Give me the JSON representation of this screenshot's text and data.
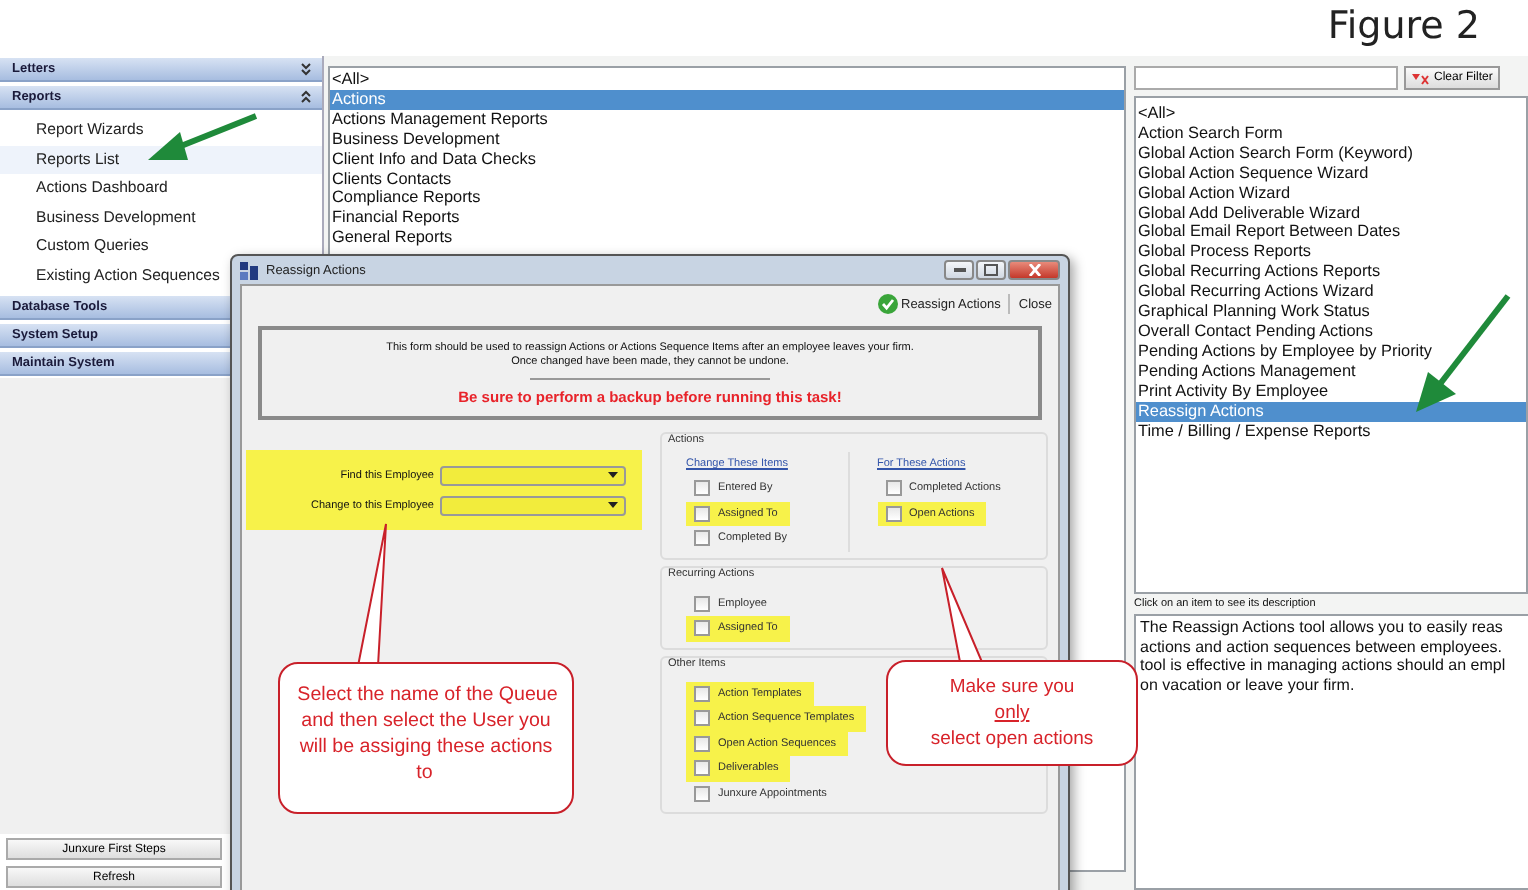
{
  "figure_label": "Figure 2",
  "sidebar": {
    "sections": [
      {
        "label": "Letters",
        "expanded": false
      },
      {
        "label": "Reports",
        "expanded": true,
        "items": [
          {
            "label": "Report Wizards",
            "selected": false
          },
          {
            "label": "Reports List",
            "selected": true
          },
          {
            "label": "Actions Dashboard",
            "selected": false
          },
          {
            "label": "Business Development",
            "selected": false
          },
          {
            "label": "Custom Queries",
            "selected": false
          },
          {
            "label": "Existing Action Sequences",
            "selected": false
          }
        ]
      },
      {
        "label": "Database Tools",
        "expanded": false
      },
      {
        "label": "System Setup",
        "expanded": false
      },
      {
        "label": "Maintain System",
        "expanded": false
      }
    ],
    "buttons": [
      "Junxure First Steps",
      "Refresh"
    ]
  },
  "categories": [
    {
      "label": "<All>",
      "selected": false
    },
    {
      "label": "Actions",
      "selected": true
    },
    {
      "label": "Actions Management Reports",
      "selected": false
    },
    {
      "label": "Business Development",
      "selected": false
    },
    {
      "label": "Client Info and Data Checks",
      "selected": false
    },
    {
      "label": "Clients Contacts",
      "selected": false
    },
    {
      "label": "Compliance Reports",
      "selected": false
    },
    {
      "label": "Financial Reports",
      "selected": false
    },
    {
      "label": "General Reports",
      "selected": false
    }
  ],
  "reports": {
    "clear_filter_button": "Clear Filter",
    "items": [
      {
        "label": "<All>",
        "selected": false
      },
      {
        "label": "Action Search Form",
        "selected": false
      },
      {
        "label": "Global Action Search Form (Keyword)",
        "selected": false
      },
      {
        "label": "Global Action Sequence Wizard",
        "selected": false
      },
      {
        "label": "Global Action Wizard",
        "selected": false
      },
      {
        "label": "Global Add Deliverable Wizard",
        "selected": false
      },
      {
        "label": "Global Email Report Between Dates",
        "selected": false
      },
      {
        "label": "Global Process Reports",
        "selected": false
      },
      {
        "label": "Global Recurring Actions Reports",
        "selected": false
      },
      {
        "label": "Global Recurring Actions Wizard",
        "selected": false
      },
      {
        "label": "Graphical Planning Work Status",
        "selected": false
      },
      {
        "label": "Overall Contact Pending Actions",
        "selected": false
      },
      {
        "label": "Pending Actions by Employee by Priority",
        "selected": false
      },
      {
        "label": "Pending Actions Management",
        "selected": false
      },
      {
        "label": "Print Activity By Employee",
        "selected": false
      },
      {
        "label": "Reassign Actions",
        "selected": true
      },
      {
        "label": "Time / Billing / Expense Reports",
        "selected": false
      }
    ],
    "description_hint": "Click on an item to see its description",
    "description_lines": [
      "The Reassign Actions tool allows you to easily reas",
      "actions and action sequences between employees.",
      "tool is effective in managing actions should an empl",
      "on vacation or leave your firm."
    ]
  },
  "dialog": {
    "title": "Reassign Actions",
    "toolbar": {
      "run_button": "Reassign Actions",
      "close_button": "Close"
    },
    "info_lines": [
      "This form should be used to reassign Actions or Actions Sequence Items after an employee leaves your firm.",
      "Once changed have been made, they cannot be undone."
    ],
    "warning": "Be sure to perform a backup before running this task!",
    "employee_fields": {
      "highlighted": true,
      "fields": [
        {
          "label": "Find this Employee"
        },
        {
          "label": "Change to this Employee"
        }
      ]
    },
    "actions_group": {
      "legend": "Actions",
      "columns": [
        {
          "heading": "Change These Items",
          "options": [
            {
              "label": "Entered By",
              "checked": false,
              "highlighted": false
            },
            {
              "label": "Assigned To",
              "checked": false,
              "highlighted": true
            },
            {
              "label": "Completed By",
              "checked": false,
              "highlighted": false
            }
          ]
        },
        {
          "heading": "For These Actions",
          "options": [
            {
              "label": "Completed Actions",
              "checked": false,
              "highlighted": false
            },
            {
              "label": "Open Actions",
              "checked": false,
              "highlighted": true
            }
          ]
        }
      ]
    },
    "recurring_group": {
      "legend": "Recurring Actions",
      "options": [
        {
          "label": "Employee",
          "checked": false,
          "highlighted": false
        },
        {
          "label": "Assigned To",
          "checked": false,
          "highlighted": true
        }
      ]
    },
    "other_group": {
      "legend": "Other Items",
      "options": [
        {
          "label": "Action Templates",
          "checked": false,
          "highlighted": true
        },
        {
          "label": "Action Sequence Templates",
          "checked": false,
          "highlighted": true
        },
        {
          "label": "Open Action Sequences",
          "checked": false,
          "highlighted": true
        },
        {
          "label": "Deliverables",
          "checked": false,
          "highlighted": true
        },
        {
          "label": "Junxure Appointments",
          "checked": false,
          "highlighted": false
        }
      ]
    }
  },
  "callouts": [
    {
      "kind": "left",
      "segments": [
        {
          "text": "Select the name of the Queue and then select the User you will be assiging these actions to",
          "underlined": false
        }
      ]
    },
    {
      "kind": "right",
      "segments": [
        {
          "text": "Make sure you",
          "underlined": false
        },
        {
          "text": "only",
          "underlined": true
        },
        {
          "text": "select open actions",
          "underlined": false
        }
      ]
    }
  ]
}
